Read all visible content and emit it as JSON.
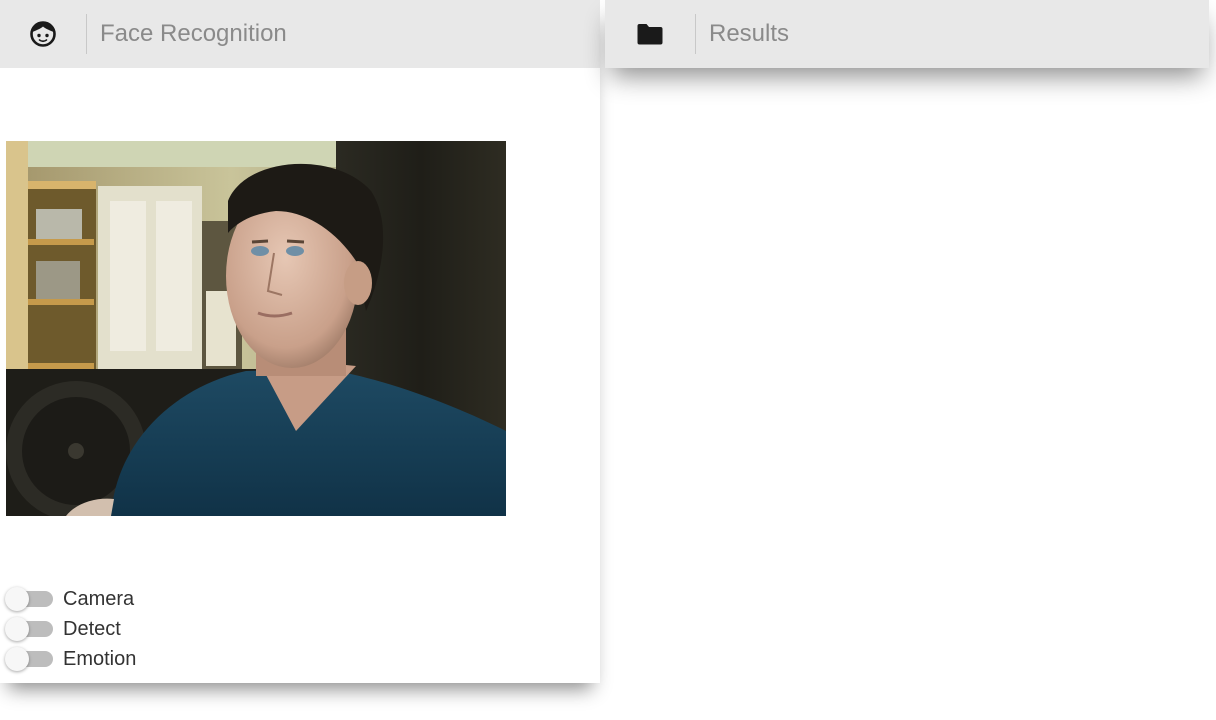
{
  "face_panel": {
    "title": "Face Recognition",
    "icon": "face-icon",
    "camera_feed": "webcam-frame",
    "toggles": [
      {
        "label": "Camera",
        "on": false
      },
      {
        "label": "Detect",
        "on": false
      },
      {
        "label": "Emotion",
        "on": false
      }
    ]
  },
  "results_panel": {
    "title": "Results",
    "icon": "folder-icon"
  },
  "colors": {
    "header_bg": "#e8e8e8",
    "title_text": "#8a8a8a",
    "switch_track": "#bdbdbd",
    "switch_thumb": "#f7f7f7"
  }
}
